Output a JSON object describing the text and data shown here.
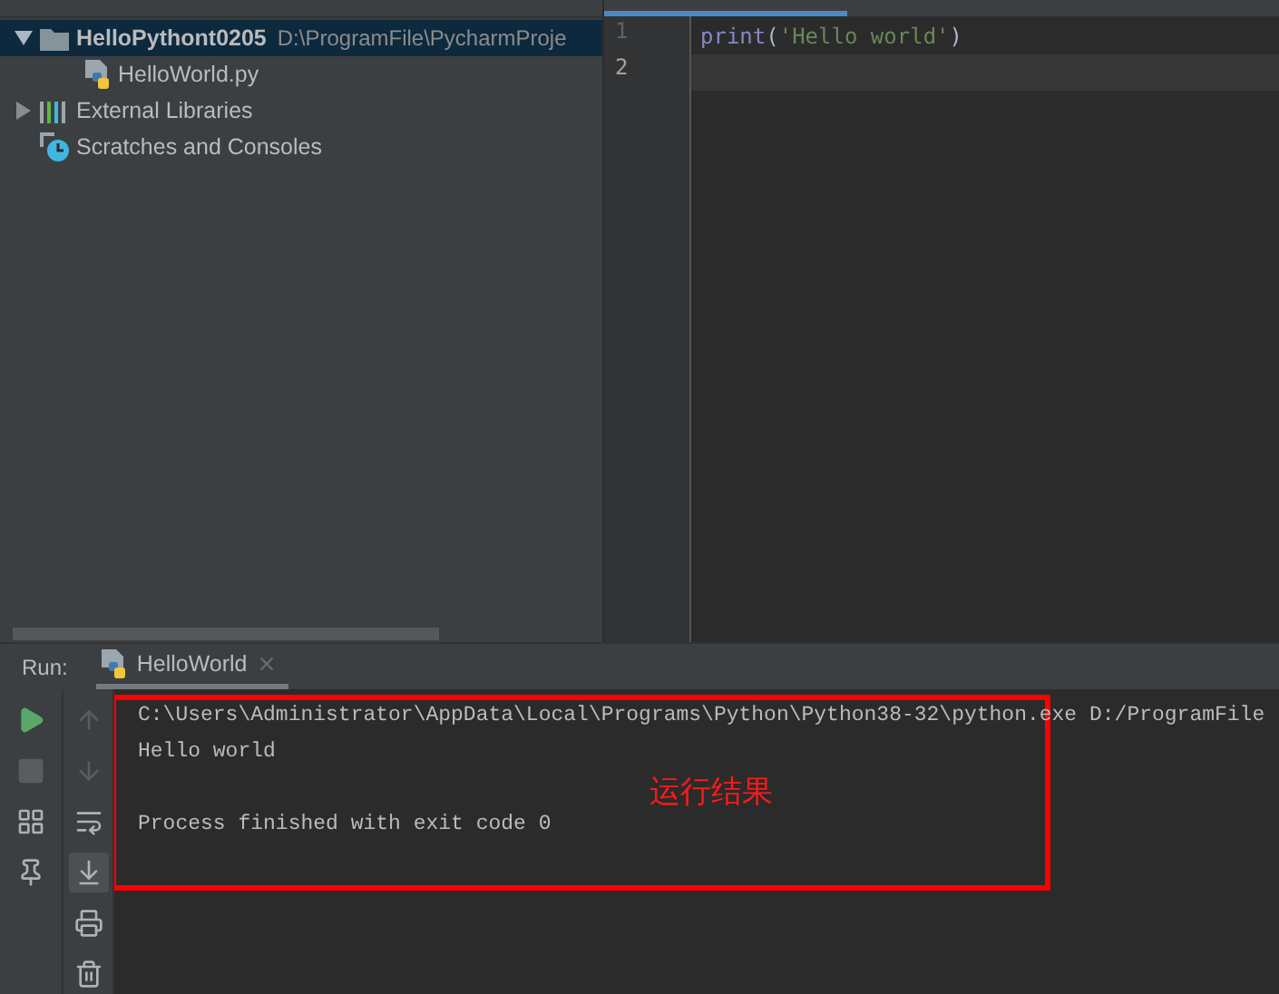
{
  "project_tree": [
    {
      "kind": "folder",
      "label": "HelloPythont0205",
      "path": "D:\\ProgramFile\\PycharmProje",
      "expanded": true,
      "selected": true,
      "children": [
        {
          "kind": "python-file",
          "label": "HelloWorld.py",
          "selected": false
        }
      ]
    },
    {
      "kind": "libraries",
      "label": "External Libraries",
      "expanded": false,
      "selected": false
    },
    {
      "kind": "scratches",
      "label": "Scratches and Consoles",
      "selected": false
    }
  ],
  "editor": {
    "lines": [
      {
        "number": "1",
        "current": false,
        "tokens": [
          {
            "kind": "builtin",
            "text": "print"
          },
          {
            "kind": "punct",
            "text": "("
          },
          {
            "kind": "string",
            "text": "'Hello world'"
          },
          {
            "kind": "punct",
            "text": ")"
          }
        ]
      },
      {
        "number": "2",
        "current": true
      }
    ]
  },
  "run": {
    "label": "Run:",
    "tab": {
      "label": "HelloWorld",
      "selected": true
    }
  },
  "console": {
    "command": "C:\\Users\\Administrator\\AppData\\Local\\Programs\\Python\\Python38-32\\python.exe D:/ProgramFile",
    "output": "Hello world",
    "exit_message": "Process finished with exit code 0"
  },
  "annotation": {
    "text": "运行结果"
  }
}
